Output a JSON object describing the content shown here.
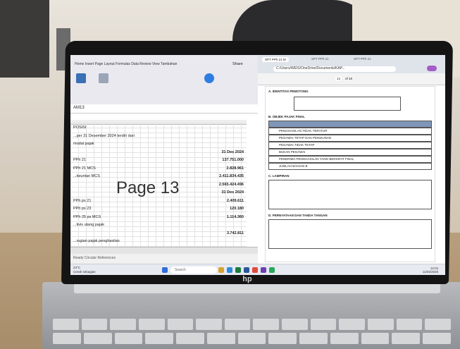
{
  "excel": {
    "ribbon_tabs": "Home  Insert  Page Layout  Formulas  Data  Review  View  Tambahan",
    "share_label": "Share",
    "namebox": "AM13",
    "rows": [
      {
        "label": "POSISI",
        "value": ""
      },
      {
        "label": "...per 31 Desember 2024 terdiri dari",
        "value": ""
      },
      {
        "label": "modal pajak",
        "value": ""
      },
      {
        "label": "",
        "value": "31 Des 2024"
      },
      {
        "label": "PPh 21",
        "value": "137.751.000"
      },
      {
        "label": "PPh 21 MCS",
        "value": "2.828.961"
      },
      {
        "label": "...keuntan MCS",
        "value": "2.411.834.435"
      },
      {
        "label": "",
        "value": "2.565.424.496"
      },
      {
        "label": "",
        "value": "31 Des 2024"
      },
      {
        "label": "PPh ps 21",
        "value": "2.409.611"
      },
      {
        "label": "PPh ps 23",
        "value": "120.180"
      },
      {
        "label": "PPh 25 ps MCS",
        "value": "1.114.360"
      },
      {
        "label": "...tivis utang pajak",
        "value": ""
      },
      {
        "label": "",
        "value": "3.742.811"
      },
      {
        "label": "...rugian pajak penghasilan",
        "value": ""
      }
    ],
    "watermark": "Page 13",
    "status": "Ready   Circular References"
  },
  "pdf": {
    "tab1": "SPT PPh 21 M",
    "tab2": "SPT PPh 21",
    "tab3": "SPT PPh 21",
    "url": "C:/Users/WEIS/OneDrive/Documents/KAP...",
    "page_num": "14",
    "page_total": "of 19",
    "rows": [
      "PENGHASILAN TIDAK TERATUR",
      "PEGAWAI TETAP DAN PENSIUNAN",
      "PEGAWAI TIDAK TETAP",
      "BUKAN PEGAWAI",
      "PENERIMA PENGHASILAN YANG BERSIFAT FINAL",
      "JUMLAH BAGIAN B"
    ],
    "section_a": "A. IDENTITAS PEMOTONG",
    "section_b": "B. OBJEK PAJAK FINAL",
    "section_c": "C. LAMPIRAN",
    "section_d": "D. PERNYATAAN DAN TANDA TANGAN"
  },
  "taskbar": {
    "weather_temp": "24°C",
    "weather_desc": "Cerah sebagian",
    "search": "Search",
    "time": "12:01",
    "date": "11/02/2025"
  },
  "brand": "hp"
}
